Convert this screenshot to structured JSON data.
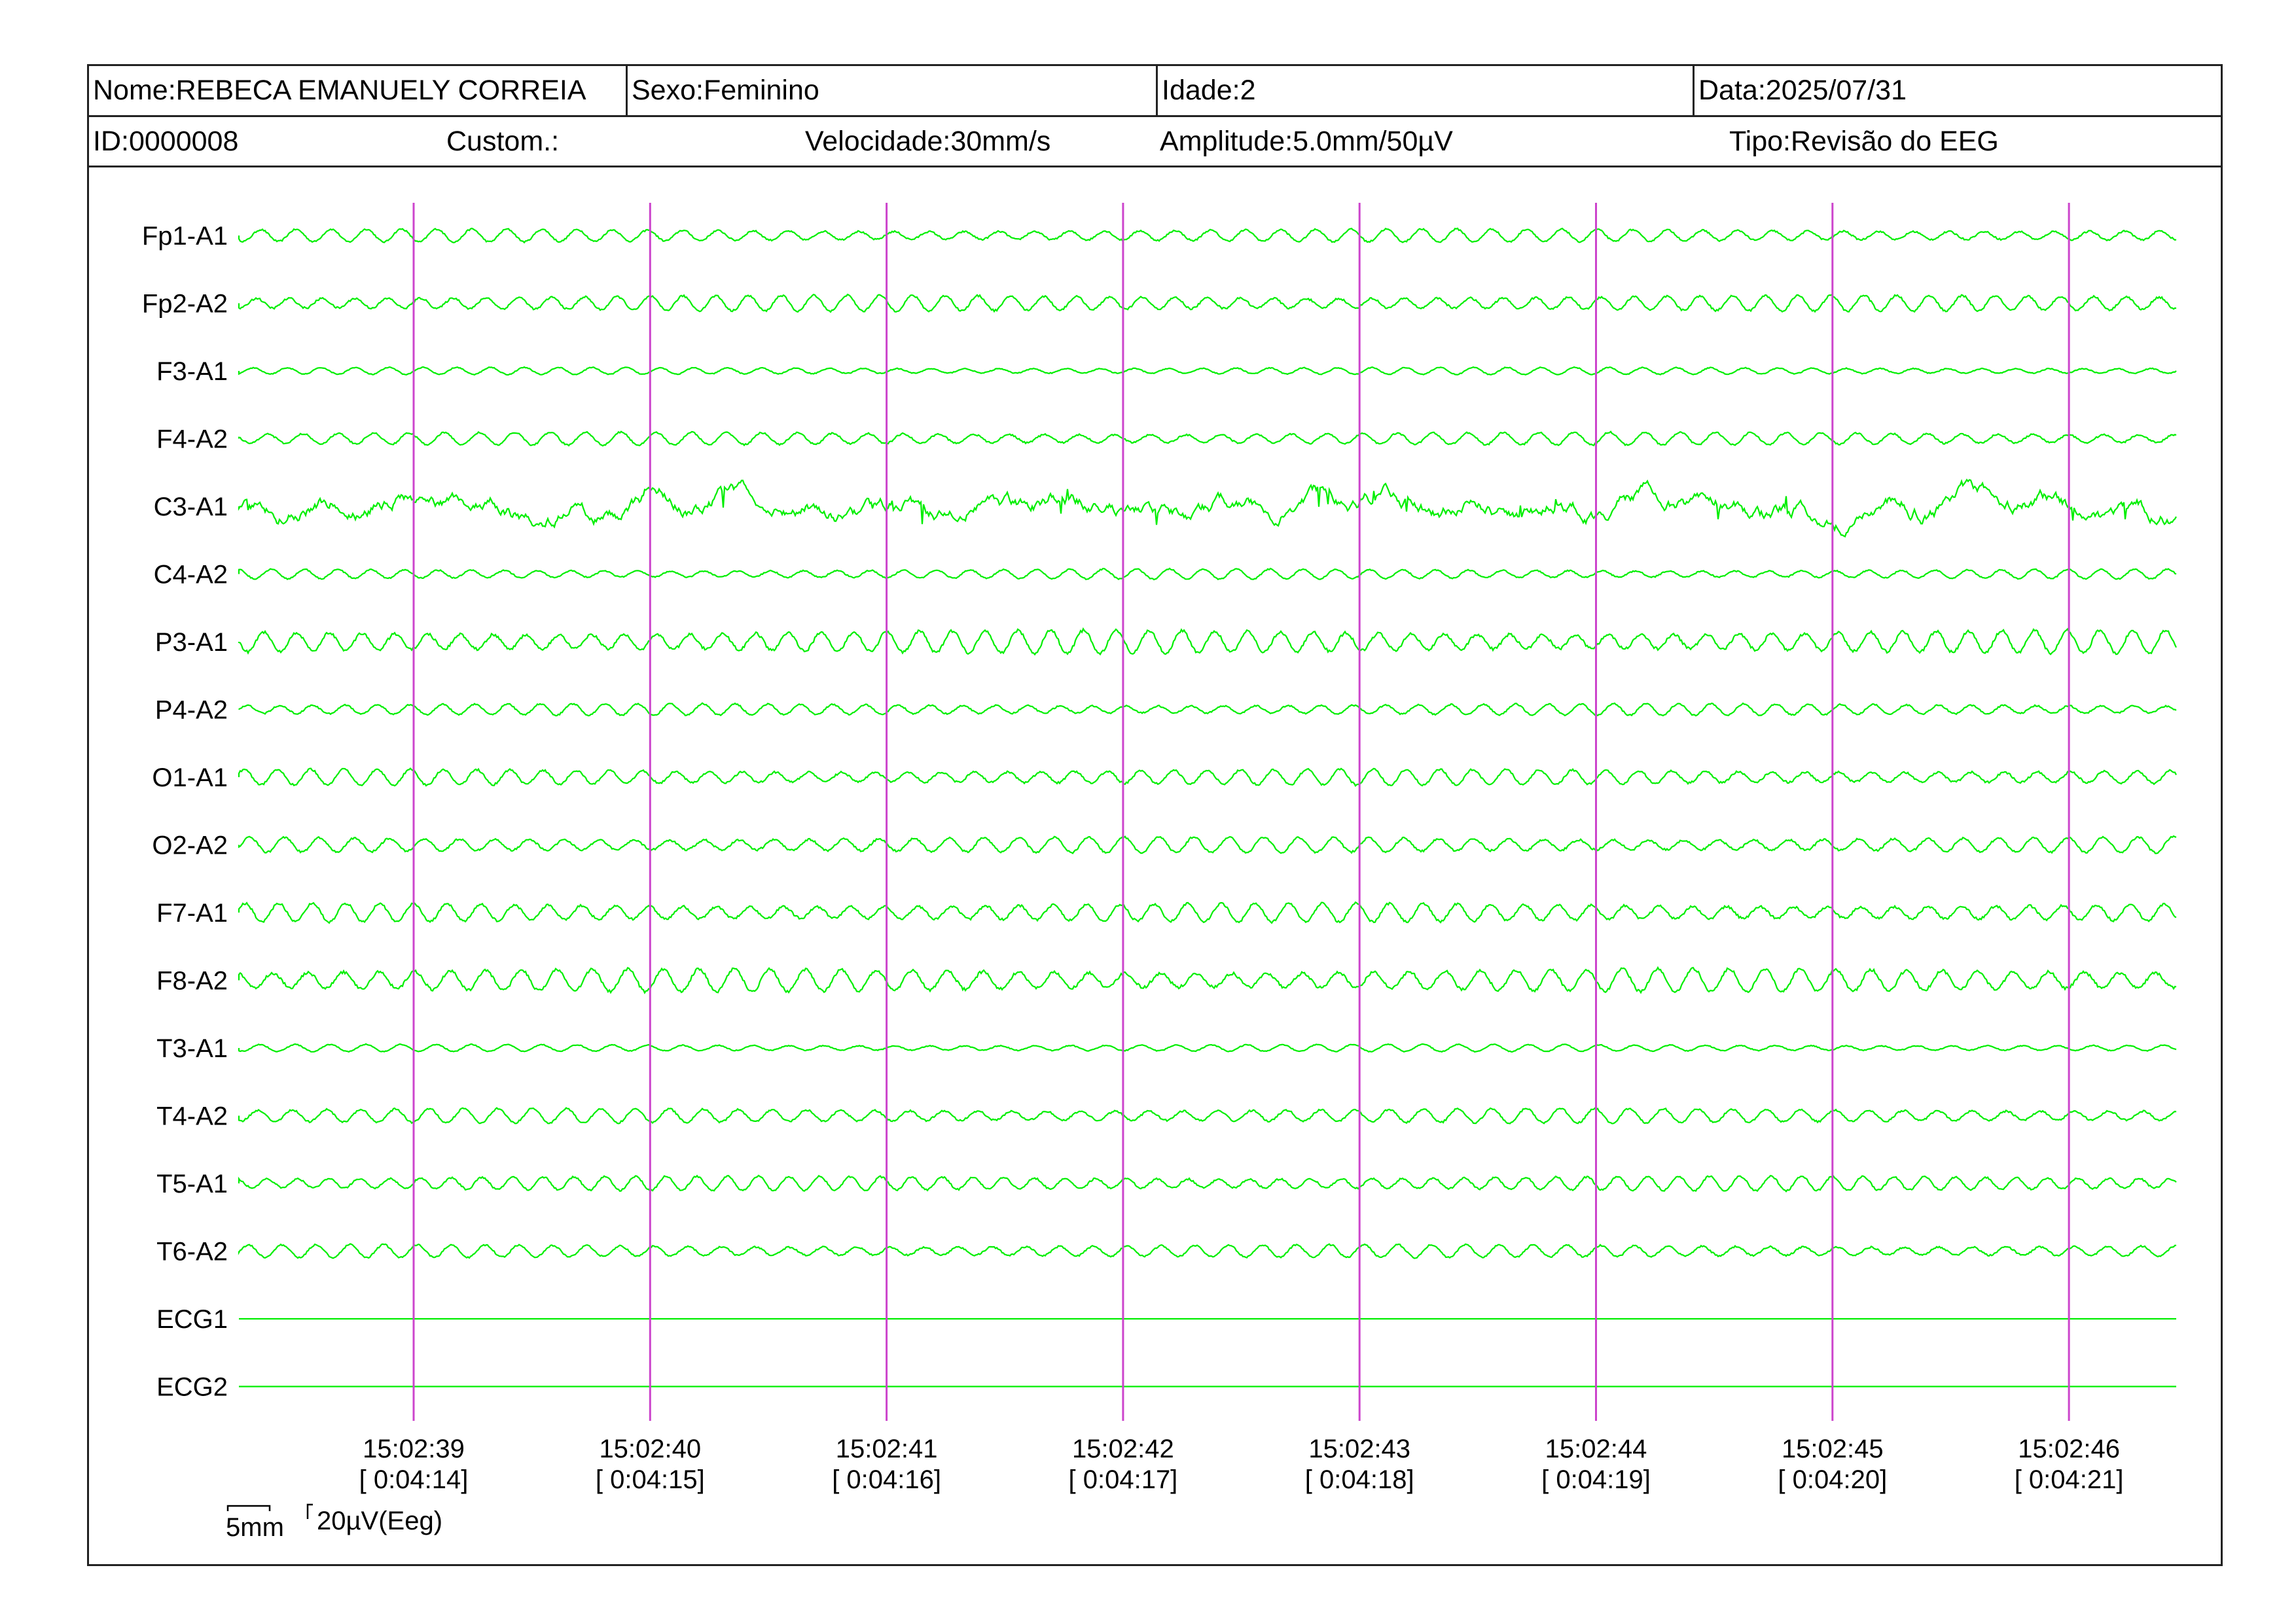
{
  "header": {
    "nome_label": "Nome:",
    "nome": "REBECA EMANUELY CORREIA",
    "sexo_label": "Sexo:",
    "sexo": "Feminino",
    "idade_label": "Idade:",
    "idade": "2",
    "data_label": "Data:",
    "data": "2025/07/31",
    "id_label": "ID:",
    "id": "0000008",
    "custom_label": "Custom.:",
    "velocidade_label": "Velocidade:",
    "velocidade": "30mm/s",
    "amplitude_label": "Amplitude:",
    "amplitude": "5.0mm/50µV",
    "tipo_label": "Tipo:",
    "tipo": "Revisão do EEG"
  },
  "chart_data": {
    "type": "line",
    "title": "",
    "channels": [
      "Fp1-A1",
      "Fp2-A2",
      "F3-A1",
      "F4-A2",
      "C3-A1",
      "C4-A2",
      "P3-A1",
      "P4-A2",
      "O1-A1",
      "O2-A2",
      "F7-A1",
      "F8-A2",
      "T3-A1",
      "T4-A2",
      "T5-A1",
      "T6-A2",
      "ECG1",
      "ECG2"
    ],
    "channel_amplitude_relative": [
      0.45,
      0.55,
      0.25,
      0.45,
      1.0,
      0.35,
      0.8,
      0.4,
      0.55,
      0.55,
      0.65,
      0.8,
      0.25,
      0.5,
      0.5,
      0.45,
      0,
      0
    ],
    "time_markers": [
      {
        "clock": "15:02:39",
        "elapsed": "[ 0:04:14]"
      },
      {
        "clock": "15:02:40",
        "elapsed": "[ 0:04:15]"
      },
      {
        "clock": "15:02:41",
        "elapsed": "[ 0:04:16]"
      },
      {
        "clock": "15:02:42",
        "elapsed": "[ 0:04:17]"
      },
      {
        "clock": "15:02:43",
        "elapsed": "[ 0:04:18]"
      },
      {
        "clock": "15:02:44",
        "elapsed": "[ 0:04:19]"
      },
      {
        "clock": "15:02:45",
        "elapsed": "[ 0:04:20]"
      },
      {
        "clock": "15:02:46",
        "elapsed": "[ 0:04:21]"
      }
    ],
    "x_start_seconds": 254.27,
    "x_end_seconds": 262.43,
    "trace_color": "#00ee00",
    "marker_color": "#cc44cc",
    "scale_bar": {
      "time": "5mm",
      "amplitude": "20µV(Eeg)"
    }
  }
}
